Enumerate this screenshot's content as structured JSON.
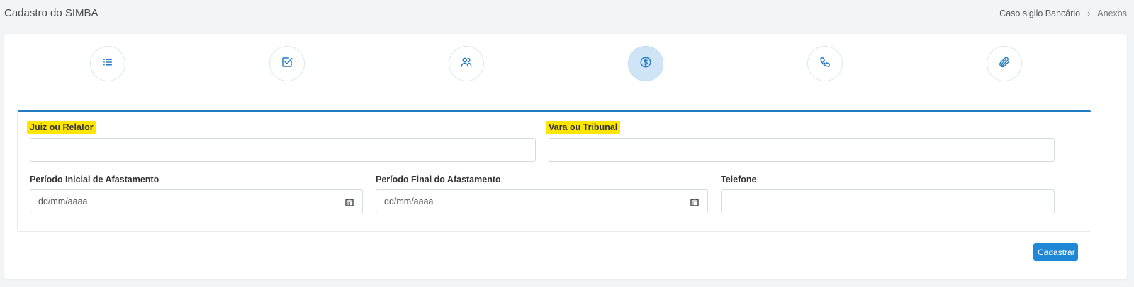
{
  "header": {
    "title": "Cadastro do SIMBA",
    "breadcrumb": [
      "Caso sigilo Bancário",
      "Anexos"
    ],
    "breadcrumb_separator": "›"
  },
  "stepper": {
    "steps": [
      {
        "icon": "list-icon",
        "active": false
      },
      {
        "icon": "checkbox-icon",
        "active": false
      },
      {
        "icon": "users-icon",
        "active": false
      },
      {
        "icon": "dollar-circle-icon",
        "active": true
      },
      {
        "icon": "phone-icon",
        "active": false
      },
      {
        "icon": "paperclip-icon",
        "active": false
      }
    ],
    "accent_color": "#1f78c1",
    "active_bg": "#cfe5f7"
  },
  "form": {
    "juiz": {
      "label": "Juiz ou Relator",
      "value": ""
    },
    "vara": {
      "label": "Vara ou Tribunal",
      "value": ""
    },
    "periodo_inicial": {
      "label": "Período Inicial de Afastamento",
      "placeholder": "dd/mm/aaaa"
    },
    "periodo_final": {
      "label": "Período Final do Afastamento",
      "placeholder": "dd/mm/aaaa"
    },
    "telefone": {
      "label": "Telefone",
      "value": ""
    },
    "highlight_color": "#ffe600",
    "border_accent": "#1f7bc2"
  },
  "actions": {
    "submit_label": "Cadastrar",
    "submit_color": "#1f88d6"
  }
}
